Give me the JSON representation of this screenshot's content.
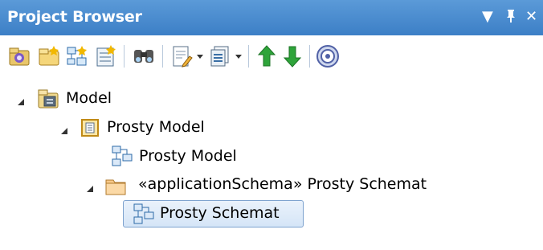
{
  "panel": {
    "title": "Project Browser",
    "controls": {
      "dropdown": "▼",
      "pin": "ф",
      "close": "✕"
    }
  },
  "toolbar": {
    "buttons": [
      {
        "name": "new-model-icon"
      },
      {
        "name": "new-package-icon"
      },
      {
        "name": "new-diagram-icon"
      },
      {
        "name": "new-element-icon"
      },
      {
        "name": "find-icon"
      },
      {
        "name": "properties-icon",
        "has_dropdown": true
      },
      {
        "name": "documentation-icon",
        "has_dropdown": true
      },
      {
        "name": "move-up-icon"
      },
      {
        "name": "move-down-icon"
      },
      {
        "name": "help-icon"
      }
    ]
  },
  "tree": {
    "model": {
      "label": "Model",
      "expanded": true
    },
    "prosty_model_pkg": {
      "label": "Prosty Model",
      "expanded": true
    },
    "prosty_model_diagram": {
      "label": "Prosty Model"
    },
    "schema_pkg": {
      "label": "«applicationSchema» Prosty Schemat",
      "expanded": true
    },
    "schema_diagram": {
      "label": "Prosty Schemat",
      "selected": true
    }
  },
  "colors": {
    "titlebar": "#4a8fd2",
    "selection_border": "#7da2ce",
    "selection_fill": "#dce9f8"
  }
}
